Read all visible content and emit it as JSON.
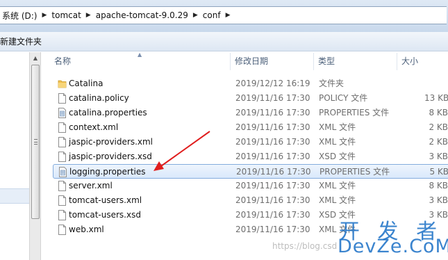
{
  "address_bar": {
    "crumbs": [
      "系统 (D:)",
      "tomcat",
      "apache-tomcat-9.0.29",
      "conf"
    ]
  },
  "toolbar": {
    "new_folder_label": "新建文件夹"
  },
  "columns": {
    "name": "名称",
    "date": "修改日期",
    "type": "类型",
    "size": "大小"
  },
  "files": [
    {
      "name": "Catalina",
      "date": "2019/12/12 16:19",
      "type": "文件夹",
      "size": "",
      "icon": "folder-icon"
    },
    {
      "name": "catalina.policy",
      "date": "2019/11/16 17:30",
      "type": "POLICY 文件",
      "size": "13 KB",
      "icon": "file-icon"
    },
    {
      "name": "catalina.properties",
      "date": "2019/11/16 17:30",
      "type": "PROPERTIES 文件",
      "size": "8 KB",
      "icon": "properties-file-icon"
    },
    {
      "name": "context.xml",
      "date": "2019/11/16 17:30",
      "type": "XML 文件",
      "size": "2 KB",
      "icon": "file-icon"
    },
    {
      "name": "jaspic-providers.xml",
      "date": "2019/11/16 17:30",
      "type": "XML 文件",
      "size": "2 KB",
      "icon": "file-icon"
    },
    {
      "name": "jaspic-providers.xsd",
      "date": "2019/11/16 17:30",
      "type": "XSD 文件",
      "size": "3 KB",
      "icon": "file-icon"
    },
    {
      "name": "logging.properties",
      "date": "2019/11/16 17:30",
      "type": "PROPERTIES 文件",
      "size": "5 KB",
      "icon": "properties-file-icon",
      "selected": true
    },
    {
      "name": "server.xml",
      "date": "2019/11/16 17:30",
      "type": "XML 文件",
      "size": "8 KB",
      "icon": "file-icon"
    },
    {
      "name": "tomcat-users.xml",
      "date": "2019/11/16 17:30",
      "type": "XML 文件",
      "size": "3 KB",
      "icon": "file-icon"
    },
    {
      "name": "tomcat-users.xsd",
      "date": "2019/11/16 17:30",
      "type": "XSD 文件",
      "size": "3 KB",
      "icon": "file-icon"
    },
    {
      "name": "web.xml",
      "date": "2019/11/16 17:30",
      "type": "XML 文件",
      "size": "",
      "icon": "file-icon"
    }
  ],
  "watermark": {
    "url": "https://blog.csd",
    "logo_cn": "开 发 者",
    "logo_en": "DevZe.CoM"
  },
  "colors": {
    "annotation_arrow": "#e01e1e",
    "selection_border": "#84acdd",
    "watermark_blue": "#2677c9"
  }
}
